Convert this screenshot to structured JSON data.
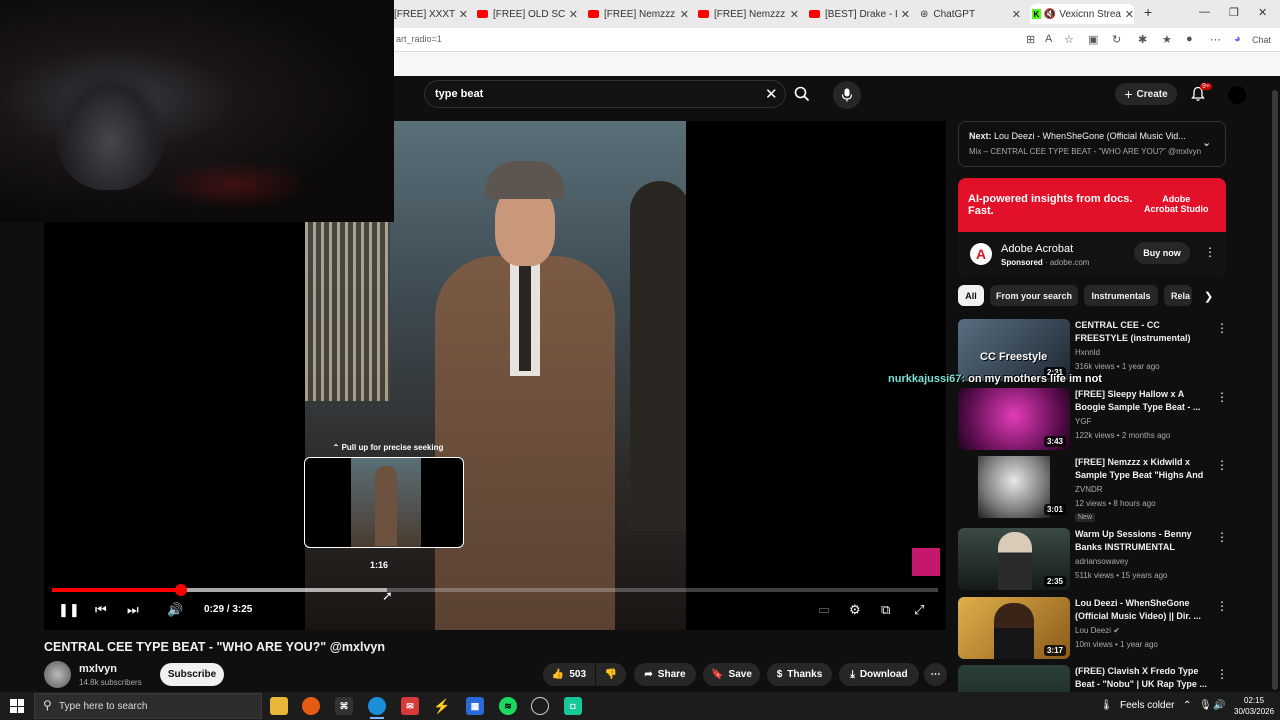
{
  "browser": {
    "tabs": [
      {
        "label": "[FREE] XXXTENTACION",
        "type": "yt"
      },
      {
        "label": "[FREE] OLD SCHOOL",
        "type": "yt"
      },
      {
        "label": "[FREE] Nemzzz x Kno",
        "type": "yt"
      },
      {
        "label": "[FREE] Nemzzz x Chi",
        "type": "yt"
      },
      {
        "label": "[BEST] Drake - Lemon",
        "type": "yt"
      },
      {
        "label": "ChatGPT",
        "type": "gpt"
      },
      {
        "label": "Vexicnn Stream",
        "type": "kick"
      }
    ],
    "new_tab": "+",
    "address_text": "art_radio=1",
    "copilot_label": "Chat"
  },
  "youtube": {
    "search_value": "type beat",
    "create_label": "Create",
    "notifications_count": "9+",
    "player": {
      "seek_hint": "Pull up for precise seeking",
      "seek_time": "1:16",
      "current_time": "0:29",
      "duration": "3:25",
      "timecode": "0:29 / 3:25",
      "played_fraction": 0.146,
      "buffered_fraction": 0.378
    },
    "video": {
      "title": "CENTRAL CEE TYPE BEAT - \"WHO ARE YOU?\" @mxlvyn",
      "channel": "mxlvyn",
      "subscribers": "14.8k subscribers",
      "subscribe_label": "Subscribe",
      "likes": "503",
      "share_label": "Share",
      "save_label": "Save",
      "thanks_label": "Thanks",
      "download_label": "Download"
    },
    "next_up": {
      "title_prefix": "Next:",
      "title": "Lou Deezi - WhenSheGone (Official Music Vid...",
      "subtitle": "Mix – CENTRAL CEE TYPE BEAT - \"WHO ARE YOU?\" @mxlvyn"
    },
    "ad": {
      "headline": "AI-powered insights from docs. Fast.",
      "brand_line1": "Adobe",
      "brand_line2": "Acrobat Studio",
      "name": "Adobe Acrobat",
      "sponsored": "Sponsored",
      "domain": "adobe.com",
      "cta": "Buy now"
    },
    "chips": [
      "All",
      "From your search",
      "Instrumentals",
      "Rela"
    ],
    "recommendations": [
      {
        "title": "CENTRAL CEE - CC FREESTYLE (instrumental)",
        "channel": "Hxnnld",
        "meta": "316k views • 1 year ago",
        "duration": "2:31",
        "thumb_text": "CC Freestyle",
        "color": "#3a4a58",
        "badge": ""
      },
      {
        "title": "[FREE] Sleepy Hallow x A Boogie Sample Type Beat - ...",
        "channel": "YGF",
        "meta": "122k views • 2 months ago",
        "duration": "3:43",
        "thumb_text": "",
        "color": "#b0239a",
        "badge": ""
      },
      {
        "title": "[FREE] Nemzzz x Kidwild x Sample Type Beat \"Highs And ...",
        "channel": "ZVNDR",
        "meta": "12 views • 8 hours ago",
        "duration": "3:01",
        "thumb_text": "",
        "color": "#d8d8d8",
        "badge": "New"
      },
      {
        "title": "Warm Up Sessions - Benny Banks INSTRUMENTAL",
        "channel": "adriansowavey",
        "meta": "511k views • 15 years ago",
        "duration": "2:35",
        "thumb_text": "",
        "color": "#2e3a36",
        "badge": ""
      },
      {
        "title": "Lou Deezi - WhenSheGone (Official Music Video) || Dir. ...",
        "channel": "Lou Deezi",
        "meta": "10m views • 1 year ago",
        "duration": "3:17",
        "thumb_text": "",
        "color": "#c79a3a",
        "badge": ""
      },
      {
        "title": "(FREE) Clavish X Fredo Type Beat - \"Nobu\" | UK Rap Type ...",
        "channel": "",
        "meta": "",
        "duration": "",
        "thumb_text": "",
        "color": "#2a4038",
        "badge": ""
      }
    ]
  },
  "stream_chat": {
    "user": "nurkkajussi67:",
    "message": "on my mothers life im not"
  },
  "taskbar": {
    "search_placeholder": "Type here to search",
    "weather": "Feels colder",
    "time": "02:15",
    "date": "30/03/2026"
  }
}
